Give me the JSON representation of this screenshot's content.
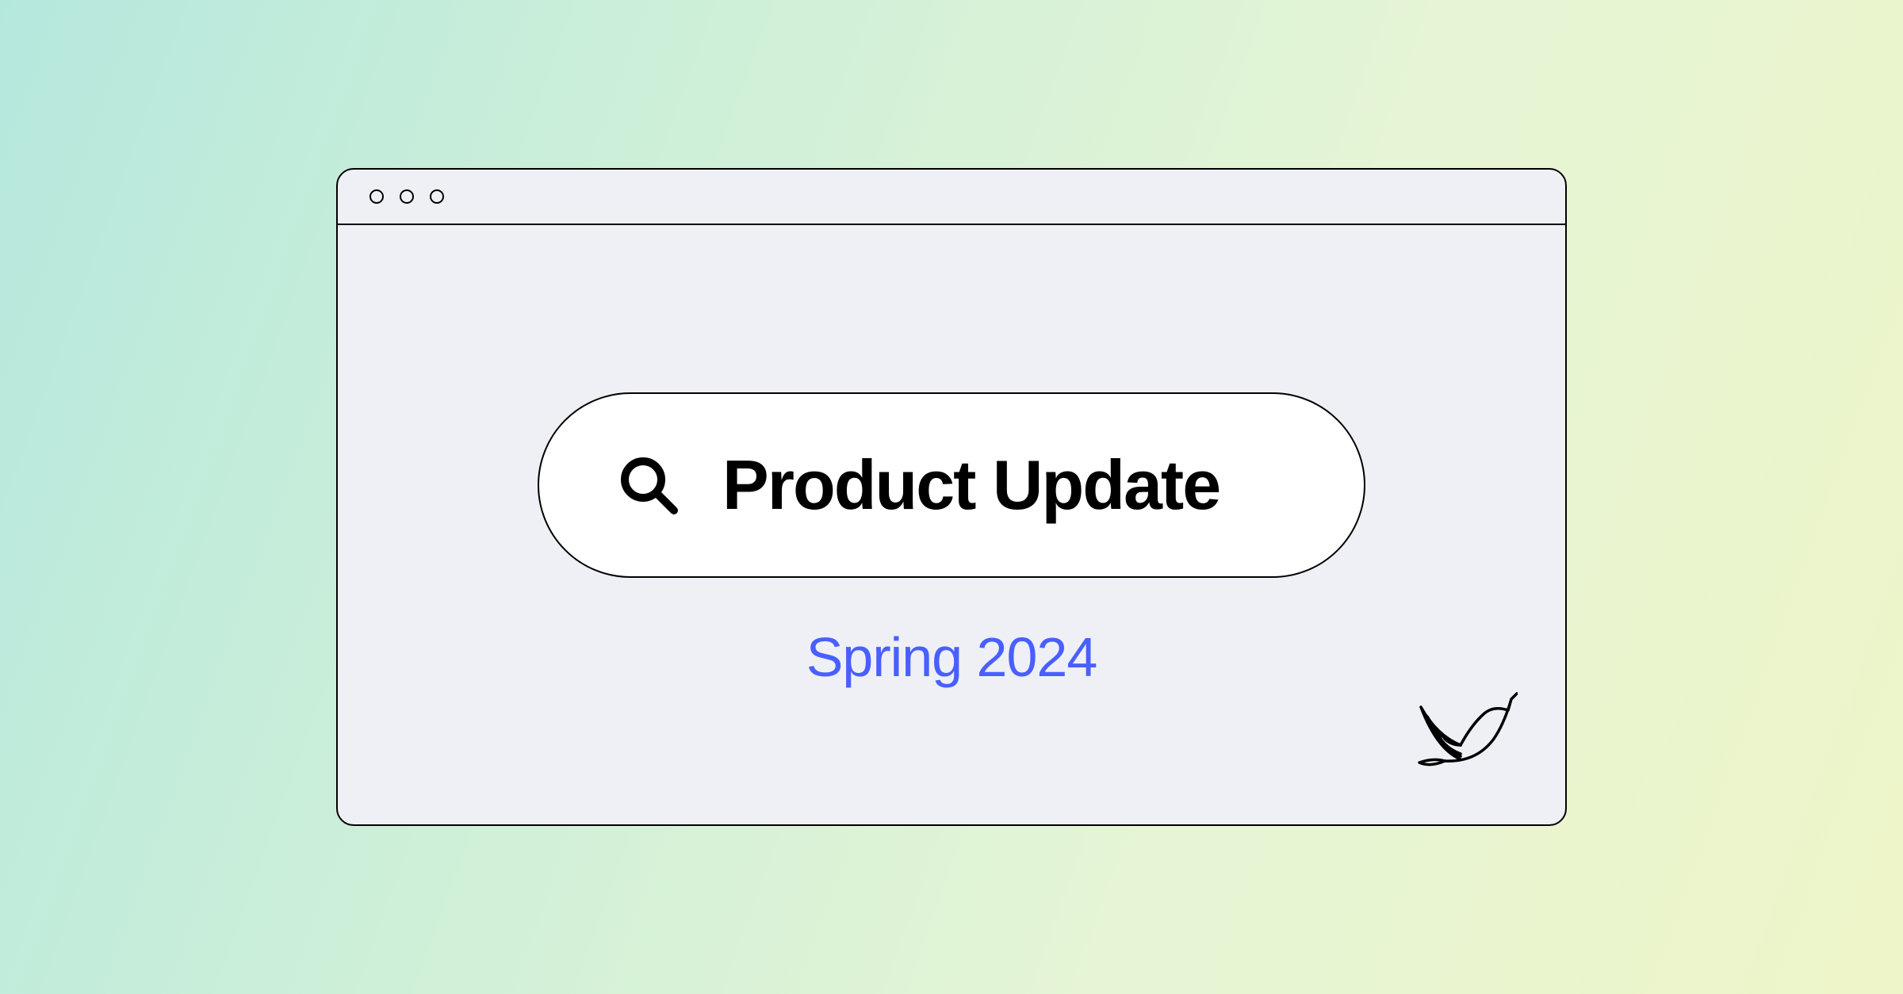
{
  "search": {
    "title": "Product Update"
  },
  "subtitle": "Spring 2024",
  "colors": {
    "subtitle": "#4a5fff",
    "stroke": "#000000",
    "window_bg": "#eef0f5",
    "pill_bg": "#ffffff"
  },
  "icons": {
    "search": "magnifying-glass",
    "logo": "hummingbird"
  }
}
